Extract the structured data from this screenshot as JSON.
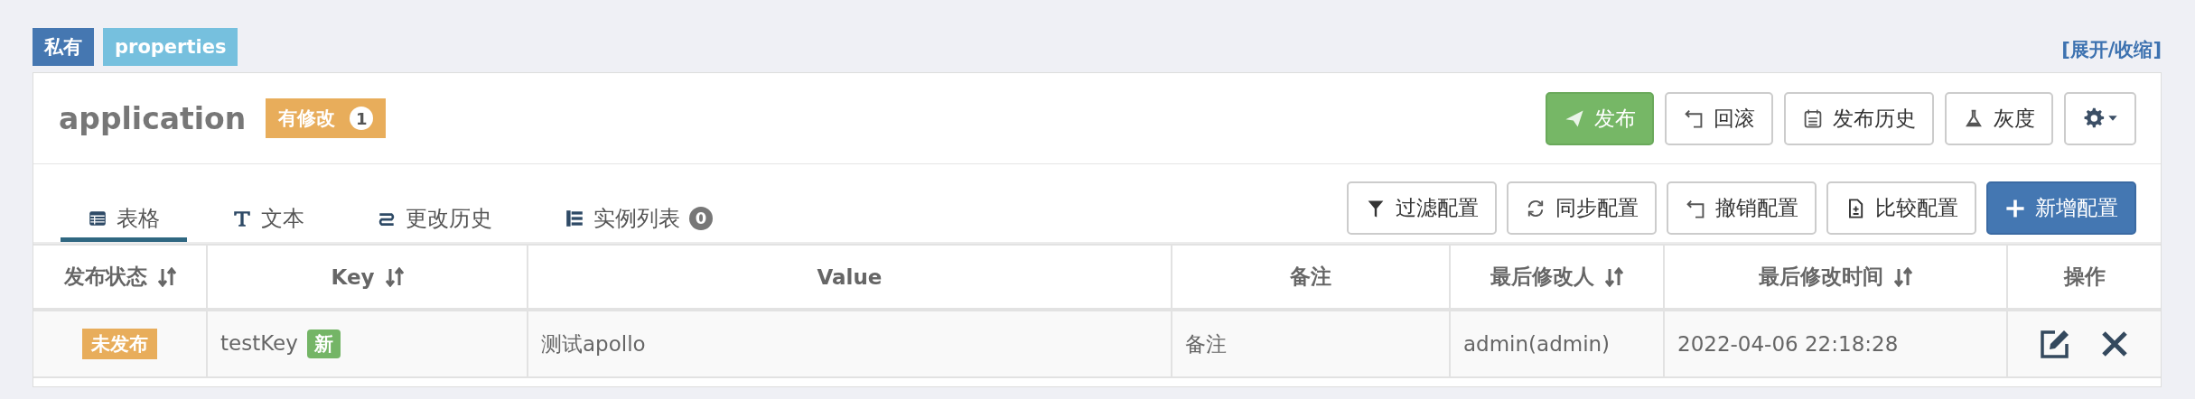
{
  "namespace_tags": [
    {
      "label": "私有",
      "kind": "scope"
    },
    {
      "label": "properties",
      "kind": "format"
    }
  ],
  "toggle_link": "[展开/收缩]",
  "header": {
    "title": "application",
    "modified_badge": {
      "label": "有修改",
      "count": "1"
    }
  },
  "actions": [
    {
      "label": "发布",
      "kind": "publish"
    },
    {
      "label": "回滚",
      "kind": "rollback"
    },
    {
      "label": "发布历史",
      "kind": "history"
    },
    {
      "label": "灰度",
      "kind": "canary"
    },
    {
      "kind": "settings"
    }
  ],
  "tabs": [
    {
      "label": "表格",
      "selected": true
    },
    {
      "label": "文本",
      "selected": false
    },
    {
      "label": "更改历史",
      "selected": false
    },
    {
      "label": "实例列表",
      "count": "0",
      "selected": false
    }
  ],
  "config_actions": [
    {
      "label": "过滤配置",
      "kind": "filter"
    },
    {
      "label": "同步配置",
      "kind": "sync"
    },
    {
      "label": "撤销配置",
      "kind": "revoke"
    },
    {
      "label": "比较配置",
      "kind": "compare"
    },
    {
      "label": "新增配置",
      "kind": "add"
    }
  ],
  "table": {
    "columns": [
      {
        "label": "发布状态",
        "sortable": true
      },
      {
        "label": "Key",
        "sortable": true
      },
      {
        "label": "Value",
        "sortable": false
      },
      {
        "label": "备注",
        "sortable": false
      },
      {
        "label": "最后修改人",
        "sortable": true
      },
      {
        "label": "最后修改时间",
        "sortable": true
      },
      {
        "label": "操作",
        "sortable": false
      }
    ],
    "rows": [
      {
        "status": "未发布",
        "key": "testKey",
        "key_badge": "新",
        "value": "测试apollo",
        "comment": "备注",
        "modified_by": "admin(admin)",
        "modified_time": "2022-04-06 22:18:28"
      }
    ]
  }
}
